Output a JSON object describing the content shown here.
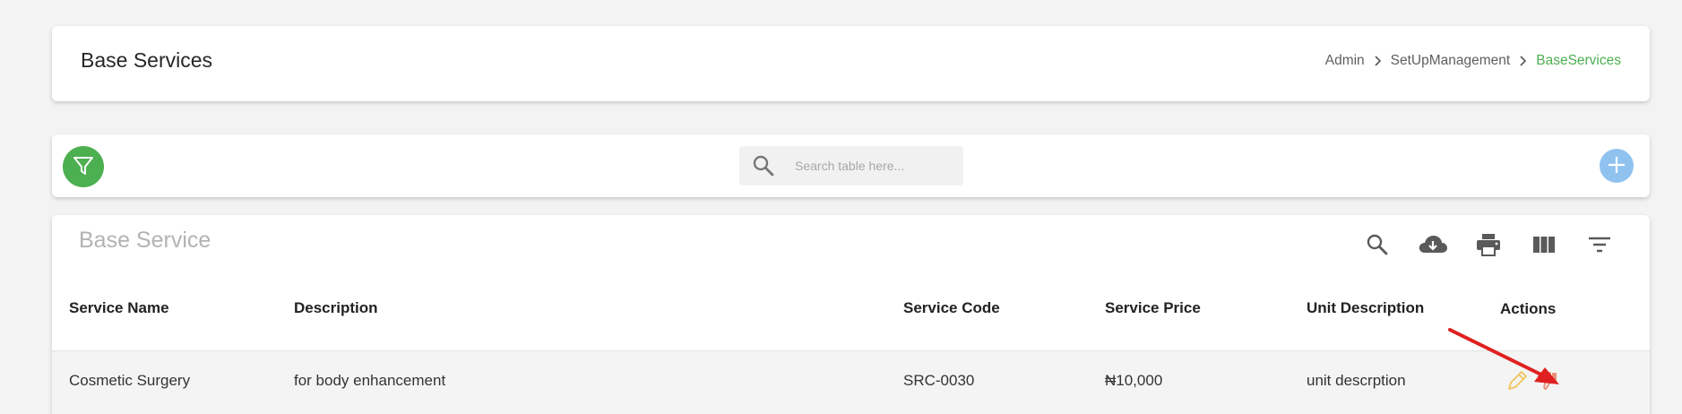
{
  "header": {
    "title": "Base Services",
    "breadcrumb": [
      "Admin",
      "SetUpManagement",
      "BaseServices"
    ]
  },
  "toolbar": {
    "search_placeholder": "Search table here...",
    "filter_icon": "filter-icon",
    "add_icon": "plus-icon"
  },
  "table": {
    "title": "Base Service",
    "tools": [
      "search-icon",
      "cloud-download-icon",
      "print-icon",
      "view-column-icon",
      "filter-list-icon"
    ],
    "columns": [
      "Service Name",
      "Description",
      "Service Code",
      "Service Price",
      "Unit Description",
      "Actions"
    ],
    "rows": [
      {
        "service_name": "Cosmetic Surgery",
        "description": "for body enhancement",
        "service_code": "SRC-0030",
        "service_price": "₦10,000",
        "unit_description": "unit descrption",
        "actions": [
          "edit-pencil-icon",
          "thumbs-down-icon"
        ]
      }
    ]
  },
  "colors": {
    "accent_green": "#4caf50",
    "add_blue": "#90c2f0",
    "edit_yellow": "#f2c45a",
    "deactivate_salmon": "#e8907a",
    "annotation_red": "#e02020"
  }
}
